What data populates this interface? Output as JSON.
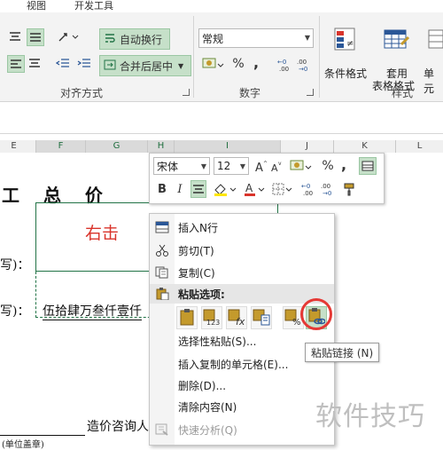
{
  "ribbon": {
    "tabs": [
      "视图",
      "开发工具"
    ],
    "wrap_text": "自动换行",
    "merge_center": "合并后居中",
    "number_format": "常规",
    "percent": "%",
    "comma": ",",
    "inc_decimal": "←0 .00",
    "dec_decimal": ".00 →0",
    "conditional_format": "条件格式",
    "format_as_table_1": "套用",
    "format_as_table_2": "表格格式",
    "cell_styles_partial": "单元",
    "group_alignment": "对齐方式",
    "group_number": "数字",
    "group_styles": "样式"
  },
  "columns": [
    "E",
    "F",
    "G",
    "H",
    "I",
    "J",
    "K",
    "L"
  ],
  "sheet": {
    "title_text": "工 总 价",
    "label1": "写)：",
    "label2": "写)：",
    "amount_text": "伍拾肆万叁仟壹仟",
    "right_click_note": "右击",
    "bottom_text": "造价咨询人",
    "bottom_small": "(单位盖章)"
  },
  "mini_toolbar": {
    "font_name": "宋体",
    "font_size": "12",
    "bold": "B",
    "italic": "I",
    "percent": "%",
    "comma": ","
  },
  "context_menu": {
    "items": [
      {
        "label": "插入N行",
        "icon": "insert-rows-icon"
      },
      {
        "label": "剪切(T)",
        "icon": "scissors-icon"
      },
      {
        "label": "复制(C)",
        "icon": "copy-icon"
      },
      {
        "label": "粘贴选项:",
        "icon": "paste-icon"
      },
      {
        "label": "选择性粘贴(S)...",
        "icon": ""
      },
      {
        "label": "插入复制的单元格(E)...",
        "icon": ""
      },
      {
        "label": "删除(D)...",
        "icon": ""
      },
      {
        "label": "清除内容(N)",
        "icon": ""
      },
      {
        "label": "快速分析(Q)",
        "icon": "quick-analysis-icon"
      }
    ],
    "paste_buttons": [
      "paste-icon",
      "paste-values-icon",
      "paste-formulas-icon",
      "paste-transpose-icon",
      "paste-formatting-icon",
      "paste-link-icon"
    ]
  },
  "tooltip": "粘贴链接 (N)",
  "watermark": "软件技巧",
  "colors": {
    "accent_green": "#217346",
    "highlight_green": "#c6e0c9",
    "red_note": "#d9342b",
    "circle_red": "#e53935"
  }
}
